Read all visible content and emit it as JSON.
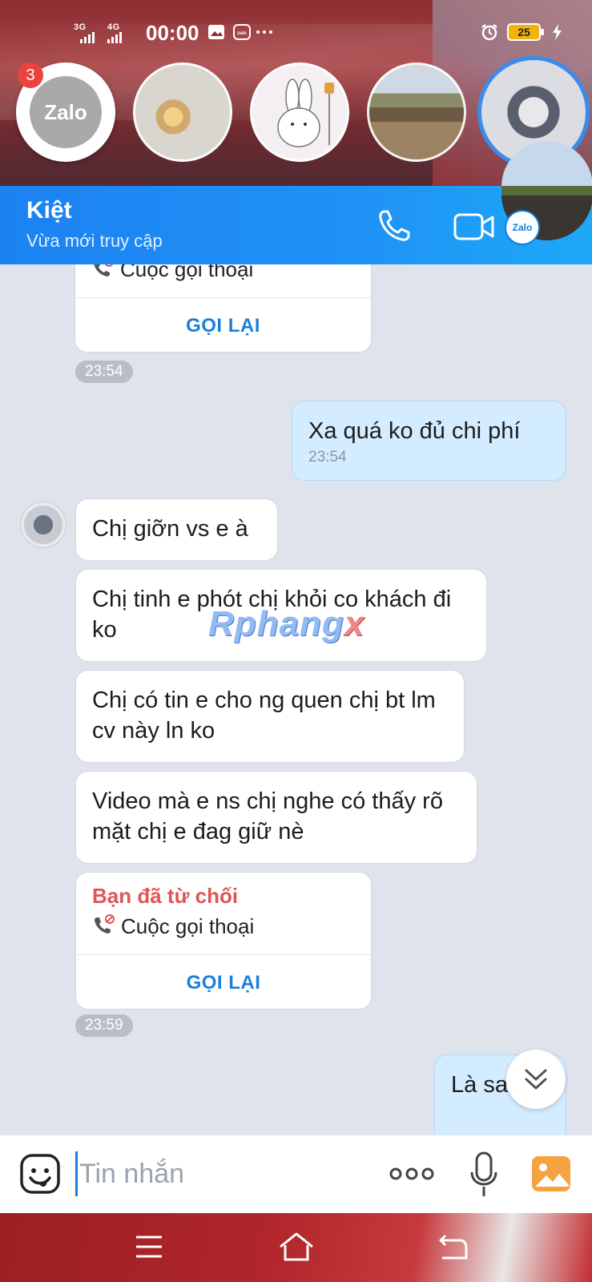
{
  "status_bar": {
    "network_1": "3G",
    "network_2": "4G",
    "time": "00:00",
    "battery": "25",
    "colors": {
      "battery_fill": "#f2b20f"
    }
  },
  "chat_heads": {
    "zalo_label": "Zalo",
    "zalo_badge": "3",
    "mini_zalo_label": "Zalo"
  },
  "header": {
    "contact_name": "Kiệt",
    "status": "Vừa mới truy cập",
    "icons": [
      "phone-icon",
      "video-camera-icon"
    ],
    "colors": {
      "background": "#1f8cf4"
    }
  },
  "messages": {
    "missed_call_1": {
      "call_type": "Cuộc gọi thoại",
      "callback_label": "GỌI LẠI",
      "time": "23:54"
    },
    "outgoing_1": {
      "text": "Xa quá ko đủ chi phí",
      "time": "23:54"
    },
    "incoming": [
      "Chị giỡn vs e à",
      "Chị tinh e phót chị khỏi co khách đi ko",
      "Chị có tin e cho ng quen chị bt lm cv này ln ko",
      "Video mà e ns chị nghe có thấy rõ mặt chị e đag giữ nè"
    ],
    "declined_call": {
      "status": "Bạn đã từ chối",
      "call_type": "Cuộc gọi thoại",
      "callback_label": "GỌI LẠI",
      "time": "23:59"
    },
    "outgoing_2": {
      "text": "Là sao"
    }
  },
  "watermark": {
    "part_1": "Rphang",
    "part_2": "x"
  },
  "input_bar": {
    "placeholder": "Tin nhắn",
    "icons": [
      "emoji-icon",
      "more-icon",
      "microphone-icon",
      "gallery-icon"
    ]
  },
  "nav_bar": {
    "icons": [
      "menu-icon",
      "home-icon",
      "back-icon"
    ]
  }
}
